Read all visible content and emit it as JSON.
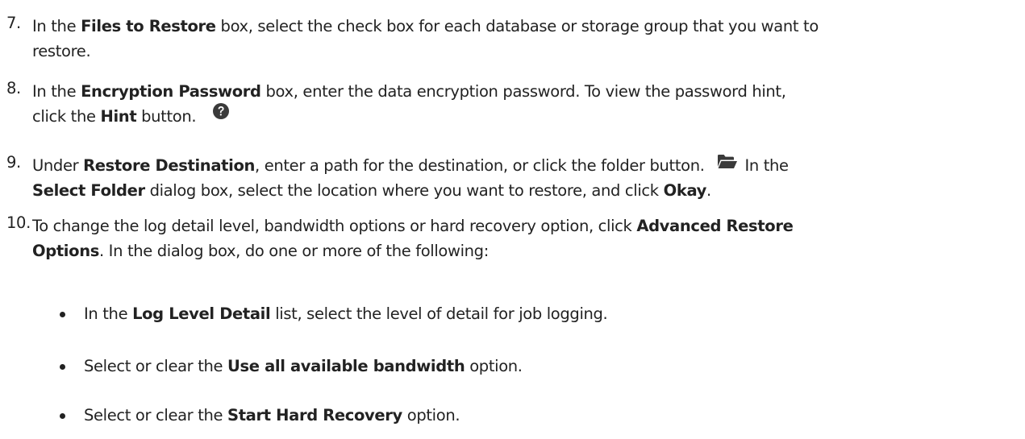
{
  "steps": [
    {
      "number": "7.",
      "lines": [
        [
          "In the ",
          "Files to Restore",
          " box, select the check box for each database or storage group that you want to"
        ],
        [
          "restore."
        ]
      ]
    },
    {
      "number": "8.",
      "lines": [
        [
          "In the ",
          "Encryption Password",
          " box, enter the data encryption password. To view the password hint,"
        ],
        [
          "click the ",
          "Hint",
          " button."
        ]
      ],
      "icon": "help-question-icon"
    },
    {
      "number": "9.",
      "lines": [
        [
          "Under ",
          "Restore Destination",
          ", enter a path for the destination, or click the folder button.",
          "In the"
        ],
        [
          "",
          "Select Folder",
          " dialog box, select the location where you want to restore, and click ",
          "Okay",
          "."
        ]
      ],
      "icon": "open-folder-icon"
    },
    {
      "number": "10.",
      "lines": [
        [
          "To change the log detail level, bandwidth options or hard recovery option, click ",
          "Advanced Restore"
        ],
        [
          "",
          "Options",
          ". In the dialog box, do one or more of the following:"
        ]
      ]
    }
  ],
  "bullets": [
    [
      "In the ",
      "Log Level Detail",
      " list, select the level of detail for job logging."
    ],
    [
      "Select or clear the ",
      "Use all available bandwidth",
      " option."
    ],
    [
      "Select or clear the ",
      "Start Hard Recovery",
      " option."
    ]
  ],
  "colors": {
    "text": "#222222",
    "icon": "#3a3a3a"
  }
}
